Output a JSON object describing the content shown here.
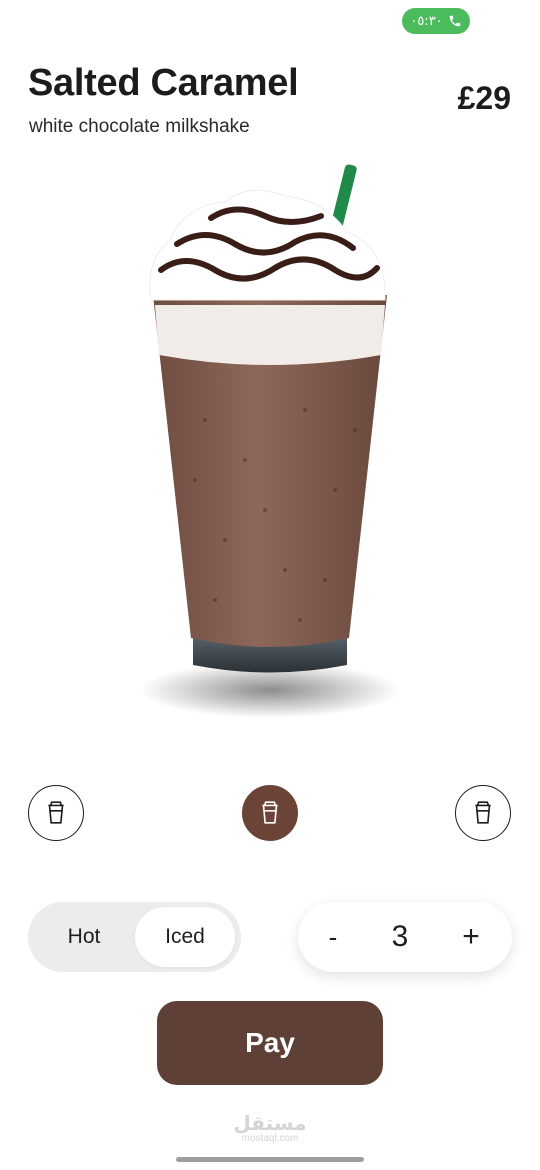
{
  "status_bar": {
    "call_time": "٠٥:٣٠",
    "call_color": "#4cbb5e"
  },
  "product": {
    "name": "Salted Caramel",
    "description": "white chocolate milkshake",
    "price": "£29"
  },
  "sizes": [
    {
      "icon": "cup-icon",
      "selected": false
    },
    {
      "icon": "cup-icon",
      "selected": true
    },
    {
      "icon": "cup-icon",
      "selected": false
    }
  ],
  "temperature": {
    "options": [
      "Hot",
      "Iced"
    ],
    "selected": "Iced"
  },
  "quantity": {
    "minus_label": "-",
    "value": "3",
    "plus_label": "+"
  },
  "pay_label": "Pay",
  "watermark": {
    "arabic": "مستقل",
    "latin": "mostaql.com"
  },
  "colors": {
    "accent": "#5f4037",
    "selected_size": "#6b4437",
    "toggle_bg": "#ececec"
  }
}
